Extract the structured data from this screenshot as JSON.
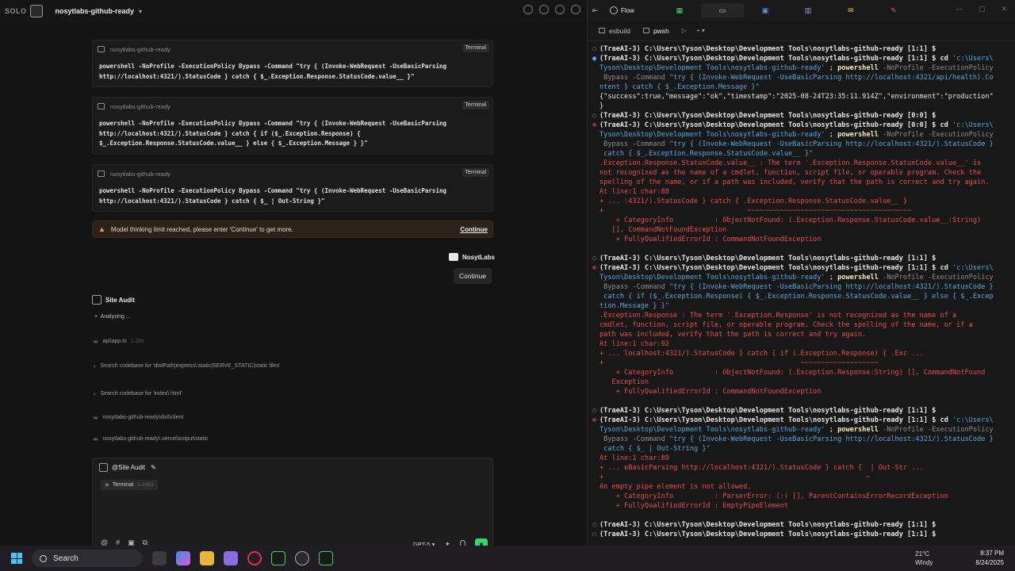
{
  "app": {
    "brand": "SOLO",
    "project": "nosytlabs-github-ready"
  },
  "commands": [
    {
      "label": "nosytlabs-github-ready",
      "tag": "Terminal",
      "text": "powershell -NoProfile -ExecutionPolicy Bypass -Command \"try { (Invoke-WebRequest -UseBasicParsing\nhttp://localhost:4321/).StatusCode } catch { $_.Exception.Response.StatusCode.value__ }\""
    },
    {
      "label": "nosytlabs-github-ready",
      "tag": "Terminal",
      "text": "powershell -NoProfile -ExecutionPolicy Bypass -Command \"try { (Invoke-WebRequest -UseBasicParsing\nhttp://localhost:4321/).StatusCode } catch { if ($_.Exception.Response) {\n$_.Exception.Response.StatusCode.value__ } else { $_.Exception.Message } }\""
    },
    {
      "label": "nosytlabs-github-ready",
      "tag": "Terminal",
      "text": "powershell -NoProfile -ExecutionPolicy Bypass -Command \"try { (Invoke-WebRequest -UseBasicParsing\nhttp://localhost:4321/).StatusCode } catch { $_ | Out-String }\""
    }
  ],
  "warning": {
    "message": "Model thinking limit reached, please enter 'Continue' to get more.",
    "link": "Continue"
  },
  "user": {
    "name": "NosytLabs",
    "message": "Continue"
  },
  "agent": {
    "name": "Site Audit",
    "status": "Analyzing ..."
  },
  "steps": [
    {
      "glyph": "∞",
      "text": "api\\app.ts",
      "range": "1-250"
    },
    {
      "glyph": "›",
      "text": "Search codebase for 'distPath|express\\.static|SERVE_STATIC|static files'",
      "range": ""
    },
    {
      "glyph": "›",
      "text": "Search codebase for 'index\\.html'",
      "range": ""
    },
    {
      "glyph": "∞",
      "text": "nosytlabs-github-ready\\dist\\client",
      "range": ""
    },
    {
      "glyph": "∞",
      "text": "nosytlabs-github-ready\\.vercel\\output\\static",
      "range": ""
    }
  ],
  "input": {
    "mention": "@Site Audit",
    "chip_label": "Terminal",
    "chip_range": "1-1052",
    "model": "GPT-5"
  },
  "terminal": {
    "toolbar_label": "Flow",
    "tabs": [
      {
        "label": "esbuild"
      },
      {
        "label": "pwsh"
      }
    ],
    "lines": [
      {
        "g": "○",
        "gc": "",
        "parts": [
          [
            "prompt",
            "(TraeAI-3) C:\\Users\\Tyson\\Desktop\\Development Tools\\nosytlabs-github-ready [1:1] $"
          ]
        ]
      },
      {
        "g": "●",
        "gc": "g-ok",
        "parts": [
          [
            "prompt",
            "(TraeAI-3) C:\\Users\\Tyson\\Desktop\\Development Tools\\nosytlabs-github-ready [1:1] $ "
          ],
          [
            "cd",
            "cd "
          ],
          [
            "path",
            "'c:\\Users\\"
          ]
        ]
      },
      {
        "g": "",
        "gc": "",
        "parts": [
          [
            "path",
            "Tyson\\Desktop\\Development Tools\\nosytlabs-github-ready'"
          ],
          [
            "out",
            " ; "
          ],
          [
            "ps",
            "powershell"
          ],
          [
            "flag",
            " -NoProfile -ExecutionPolicy"
          ]
        ]
      },
      {
        "g": "",
        "gc": "",
        "parts": [
          [
            "flag",
            " Bypass -Command "
          ],
          [
            "cmdtxt",
            "\"try { (Invoke-WebRequest -UseBasicParsing http://localhost:4321/api/health).Co"
          ]
        ]
      },
      {
        "g": "",
        "gc": "",
        "parts": [
          [
            "cmdtxt",
            "ntent } catch { $_.Exception.Message }\""
          ]
        ]
      },
      {
        "g": "",
        "gc": "",
        "parts": [
          [
            "out",
            "{\"success\":true,\"message\":\"ok\",\"timestamp\":\"2025-08-24T23:35:11.914Z\",\"environment\":\"production\""
          ]
        ]
      },
      {
        "g": "",
        "gc": "",
        "parts": [
          [
            "out",
            "}"
          ]
        ]
      },
      {
        "g": "○",
        "gc": "",
        "parts": [
          [
            "prompt",
            "(TraeAI-3) C:\\Users\\Tyson\\Desktop\\Development Tools\\nosytlabs-github-ready [0:0] $"
          ]
        ]
      },
      {
        "g": "⊗",
        "gc": "g-err",
        "parts": [
          [
            "prompt",
            "(TraeAI-3) C:\\Users\\Tyson\\Desktop\\Development Tools\\nosytlabs-github-ready [0:0] $ "
          ],
          [
            "cd",
            "cd "
          ],
          [
            "path",
            "'c:\\Users\\"
          ]
        ]
      },
      {
        "g": "",
        "gc": "",
        "parts": [
          [
            "path",
            "Tyson\\Desktop\\Development Tools\\nosytlabs-github-ready'"
          ],
          [
            "out",
            " ; "
          ],
          [
            "ps",
            "powershell"
          ],
          [
            "flag",
            " -NoProfile -ExecutionPolicy"
          ]
        ]
      },
      {
        "g": "",
        "gc": "",
        "parts": [
          [
            "flag",
            " Bypass -Command "
          ],
          [
            "cmdtxt",
            "\"try { (Invoke-WebRequest -UseBasicParsing http://localhost:4321/).StatusCode }"
          ]
        ]
      },
      {
        "g": "",
        "gc": "",
        "parts": [
          [
            "cmdtxt",
            " catch { $_.Exception.Response.StatusCode.value__ }\""
          ]
        ]
      },
      {
        "g": "",
        "gc": "",
        "parts": [
          [
            "err",
            ".Exception.Response.StatusCode.value__ : The term '.Exception.Response.StatusCode.value__' is"
          ]
        ]
      },
      {
        "g": "",
        "gc": "",
        "parts": [
          [
            "err",
            "not recognized as the name of a cmdlet, function, script file, or operable program. Check the"
          ]
        ]
      },
      {
        "g": "",
        "gc": "",
        "parts": [
          [
            "err",
            "spelling of the name, or if a path was included, verify that the path is correct and try again."
          ]
        ]
      },
      {
        "g": "",
        "gc": "",
        "parts": [
          [
            "err",
            "At line:1 char:88"
          ]
        ]
      },
      {
        "g": "",
        "gc": "",
        "parts": [
          [
            "err",
            "+ ... :4321/).StatusCode } catch { .Exception.Response.StatusCode.value__ }"
          ]
        ]
      },
      {
        "g": "",
        "gc": "",
        "parts": [
          [
            "err",
            "+                                   ~~~~~~~~~~~~~~~~~~~~~~~~~~~~~~~~~~~~~~~~"
          ]
        ]
      },
      {
        "g": "",
        "gc": "",
        "parts": [
          [
            "err",
            "    + CategoryInfo          : ObjectNotFound: (.Exception.Response.StatusCode.value__:String)"
          ]
        ]
      },
      {
        "g": "",
        "gc": "",
        "parts": [
          [
            "err",
            "   [], CommandNotFoundException"
          ]
        ]
      },
      {
        "g": "",
        "gc": "",
        "parts": [
          [
            "err",
            "    + FullyQualifiedErrorId : CommandNotFoundException"
          ]
        ]
      },
      {
        "g": "",
        "gc": "",
        "parts": [
          [
            "out",
            " "
          ]
        ]
      },
      {
        "g": "○",
        "gc": "",
        "parts": [
          [
            "prompt",
            "(TraeAI-3) C:\\Users\\Tyson\\Desktop\\Development Tools\\nosytlabs-github-ready [1:1] $"
          ]
        ]
      },
      {
        "g": "⊗",
        "gc": "g-err",
        "parts": [
          [
            "prompt",
            "(TraeAI-3) C:\\Users\\Tyson\\Desktop\\Development Tools\\nosytlabs-github-ready [1:1] $ "
          ],
          [
            "cd",
            "cd "
          ],
          [
            "path",
            "'c:\\Users\\"
          ]
        ]
      },
      {
        "g": "",
        "gc": "",
        "parts": [
          [
            "path",
            "Tyson\\Desktop\\Development Tools\\nosytlabs-github-ready'"
          ],
          [
            "out",
            " ; "
          ],
          [
            "ps",
            "powershell"
          ],
          [
            "flag",
            " -NoProfile -ExecutionPolicy"
          ]
        ]
      },
      {
        "g": "",
        "gc": "",
        "parts": [
          [
            "flag",
            " Bypass -Command "
          ],
          [
            "cmdtxt",
            "\"try { (Invoke-WebRequest -UseBasicParsing http://localhost:4321/).StatusCode }"
          ]
        ]
      },
      {
        "g": "",
        "gc": "",
        "parts": [
          [
            "cmdtxt",
            " catch { if ($_.Exception.Response) { $_.Exception.Response.StatusCode.value__ } else { $_.Excep"
          ]
        ]
      },
      {
        "g": "",
        "gc": "",
        "parts": [
          [
            "cmdtxt",
            "tion.Message } }\""
          ]
        ]
      },
      {
        "g": "",
        "gc": "",
        "parts": [
          [
            "err",
            ".Exception.Response : The term '.Exception.Response' is not recognized as the name of a"
          ]
        ]
      },
      {
        "g": "",
        "gc": "",
        "parts": [
          [
            "err",
            "cmdlet, function, script file, or operable program. Check the spelling of the name, or if a"
          ]
        ]
      },
      {
        "g": "",
        "gc": "",
        "parts": [
          [
            "err",
            "path was included, verify that the path is correct and try again."
          ]
        ]
      },
      {
        "g": "",
        "gc": "",
        "parts": [
          [
            "err",
            "At line:1 char:92"
          ]
        ]
      },
      {
        "g": "",
        "gc": "",
        "parts": [
          [
            "err",
            "+ ... localhost:4321/).StatusCode } catch { if (.Exception.Response) { .Exc ..."
          ]
        ]
      },
      {
        "g": "",
        "gc": "",
        "parts": [
          [
            "err",
            "+                                                ~~~~~~~~~~~~~~~~~~~"
          ]
        ]
      },
      {
        "g": "",
        "gc": "",
        "parts": [
          [
            "err",
            "    + CategoryInfo          : ObjectNotFound: (.Exception.Response:String) [], CommandNotFound"
          ]
        ]
      },
      {
        "g": "",
        "gc": "",
        "parts": [
          [
            "err",
            "   Exception"
          ]
        ]
      },
      {
        "g": "",
        "gc": "",
        "parts": [
          [
            "err",
            "    + FullyQualifiedErrorId : CommandNotFoundException"
          ]
        ]
      },
      {
        "g": "",
        "gc": "",
        "parts": [
          [
            "out",
            " "
          ]
        ]
      },
      {
        "g": "○",
        "gc": "",
        "parts": [
          [
            "prompt",
            "(TraeAI-3) C:\\Users\\Tyson\\Desktop\\Development Tools\\nosytlabs-github-ready [1:1] $"
          ]
        ]
      },
      {
        "g": "⊗",
        "gc": "g-err",
        "parts": [
          [
            "prompt",
            "(TraeAI-3) C:\\Users\\Tyson\\Desktop\\Development Tools\\nosytlabs-github-ready [1:1] $ "
          ],
          [
            "cd",
            "cd "
          ],
          [
            "path",
            "'c:\\Users\\"
          ]
        ]
      },
      {
        "g": "",
        "gc": "",
        "parts": [
          [
            "path",
            "Tyson\\Desktop\\Development Tools\\nosytlabs-github-ready'"
          ],
          [
            "out",
            " ; "
          ],
          [
            "ps",
            "powershell"
          ],
          [
            "flag",
            " -NoProfile -ExecutionPolicy"
          ]
        ]
      },
      {
        "g": "",
        "gc": "",
        "parts": [
          [
            "flag",
            " Bypass -Command "
          ],
          [
            "cmdtxt",
            "\"try { (Invoke-WebRequest -UseBasicParsing http://localhost:4321/).StatusCode }"
          ]
        ]
      },
      {
        "g": "",
        "gc": "",
        "parts": [
          [
            "cmdtxt",
            " catch { $_ | Out-String }\""
          ]
        ]
      },
      {
        "g": "",
        "gc": "",
        "parts": [
          [
            "err",
            "At line:1 char:89"
          ]
        ]
      },
      {
        "g": "",
        "gc": "",
        "parts": [
          [
            "err",
            "+ ... eBasicParsing http://localhost:4321/).StatusCode } catch {  | Out-Str ..."
          ]
        ]
      },
      {
        "g": "",
        "gc": "",
        "parts": [
          [
            "err",
            "+                                                                ~"
          ]
        ]
      },
      {
        "g": "",
        "gc": "",
        "parts": [
          [
            "err",
            "An empty pipe element is not allowed."
          ]
        ]
      },
      {
        "g": "",
        "gc": "",
        "parts": [
          [
            "err",
            "    + CategoryInfo          : ParserError: (:) [], ParentContainsErrorRecordException"
          ]
        ]
      },
      {
        "g": "",
        "gc": "",
        "parts": [
          [
            "err",
            "    + FullyQualifiedErrorId : EmptyPipeElement"
          ]
        ]
      },
      {
        "g": "",
        "gc": "",
        "parts": [
          [
            "out",
            " "
          ]
        ]
      },
      {
        "g": "○",
        "gc": "",
        "parts": [
          [
            "prompt",
            "(TraeAI-3) C:\\Users\\Tyson\\Desktop\\Development Tools\\nosytlabs-github-ready [1:1] $"
          ]
        ]
      },
      {
        "g": "○",
        "gc": "",
        "parts": [
          [
            "prompt",
            "(TraeAI-3) C:\\Users\\Tyson\\Desktop\\Development Tools\\nosytlabs-github-ready [1:1] $ "
          ]
        ]
      }
    ]
  },
  "taskbar": {
    "search_label": "Search",
    "weather_temp": "21°C",
    "weather_desc": "Windy",
    "time": "8:37 PM",
    "date": "8/24/2025"
  },
  "colors": {
    "accent_green": "#3fd36b",
    "error_red": "#ea4a4a",
    "path_blue": "#4fa8e0"
  }
}
